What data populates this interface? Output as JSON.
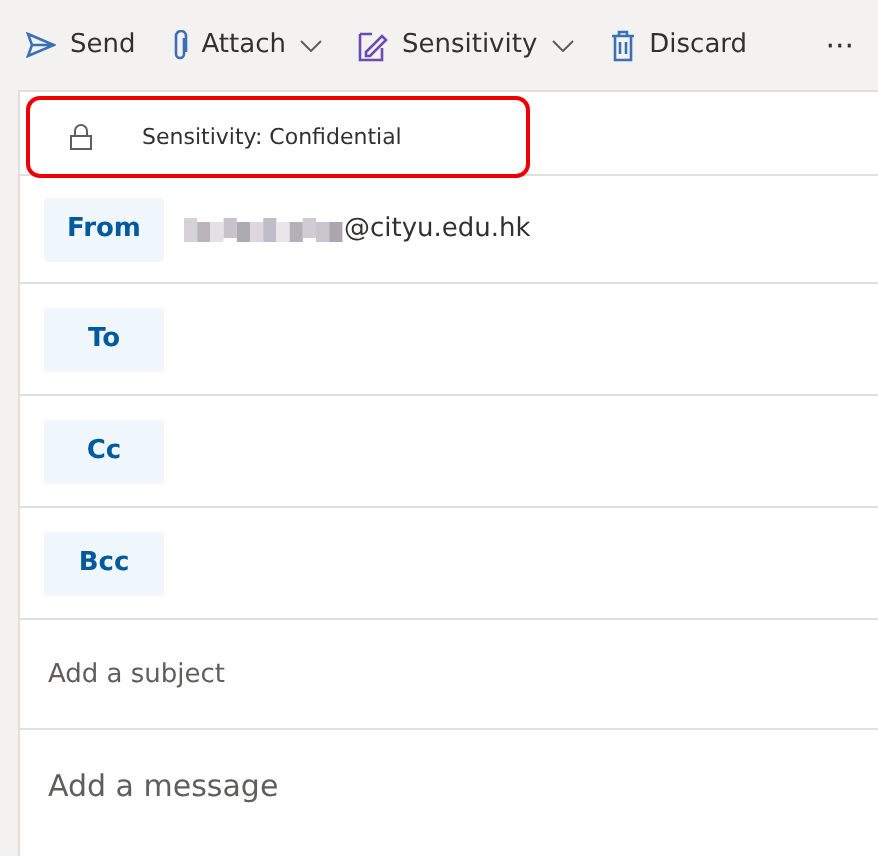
{
  "toolbar": [
    {
      "kind": "send",
      "label": "Send",
      "dropdown": false
    },
    {
      "kind": "attach",
      "label": "Attach",
      "dropdown": true
    },
    {
      "kind": "sensitivity",
      "label": "Sensitivity",
      "dropdown": true
    },
    {
      "kind": "discard",
      "label": "Discard",
      "dropdown": false
    }
  ],
  "more": "···",
  "sensitivity_bar": {
    "label": "Sensitivity: Confidential",
    "highlighted": true
  },
  "from": {
    "label": "From",
    "address": "@cityu.edu.hk",
    "redacted": true
  },
  "recipients": [
    {
      "label": "To"
    },
    {
      "label": "Cc"
    },
    {
      "label": "Bcc"
    }
  ],
  "subject": {
    "placeholder": "Add a subject"
  },
  "message": {
    "placeholder": "Add a message"
  }
}
